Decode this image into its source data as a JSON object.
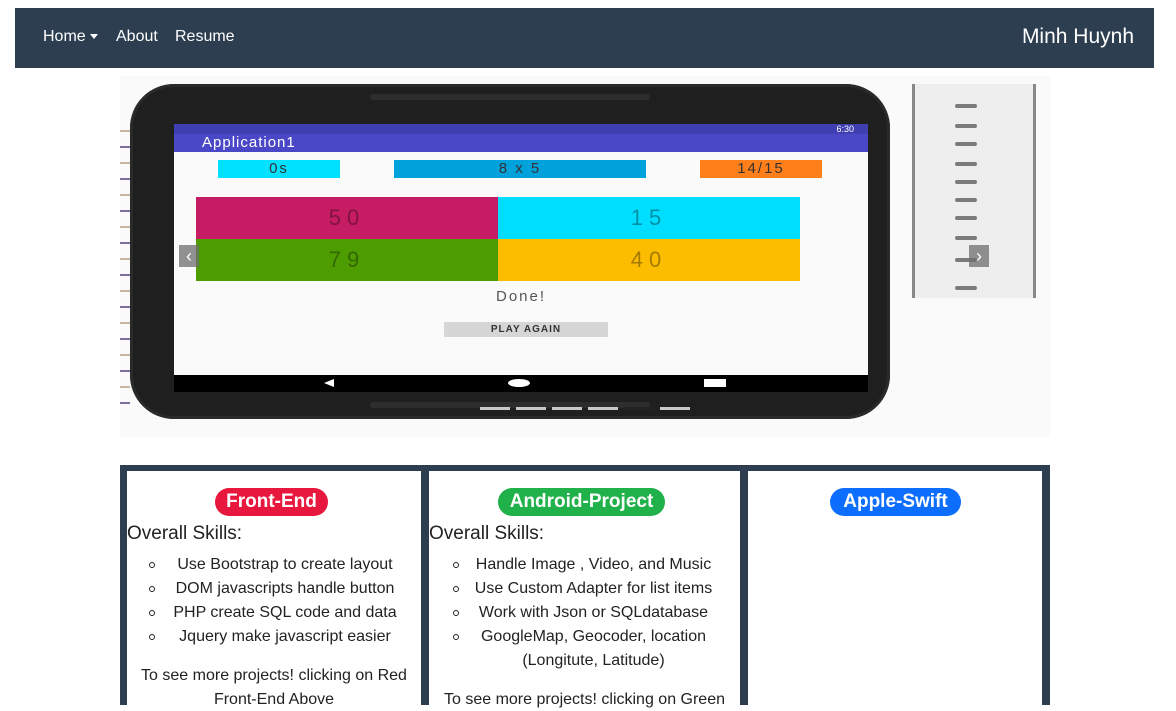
{
  "navbar": {
    "items": [
      {
        "label": "Home"
      },
      {
        "label": "About"
      },
      {
        "label": "Resume"
      }
    ],
    "brand": "Minh Huynh"
  },
  "carousel": {
    "app": {
      "status_time": "6:30",
      "title": "Application1",
      "time": "0s",
      "question": "8 x 5",
      "score": "14/15",
      "answers": [
        "50",
        "15",
        "79",
        "40"
      ],
      "done_text": "Done!",
      "play_again": "PLAY AGAIN"
    },
    "indicators": 6,
    "active_indicator": 4,
    "prev_icon": "chevron-left-icon",
    "next_icon": "chevron-right-icon"
  },
  "cards": [
    {
      "badge": "Front-End",
      "heading": "Overall Skills:",
      "skills": [
        "Use Bootstrap to create layout",
        "DOM javascripts handle button",
        "PHP create SQL code and data",
        "Jquery make javascript easier"
      ],
      "more": "To see more projects! clicking on Red Front-End Above"
    },
    {
      "badge": "Android-Project",
      "heading": "Overall Skills:",
      "skills": [
        "Handle Image , Video, and Music",
        "Use Custom Adapter for list items",
        "Work with Json or SQLdatabase",
        "GoogleMap, Geocoder, location (Longitute, Latitude)"
      ],
      "more": "To see more projects! clicking on Green"
    },
    {
      "badge": "Apple-Swift"
    }
  ],
  "colors": {
    "navbar_bg": "#2c3e50",
    "front_end": "#e8173d",
    "android": "#21b14a",
    "swift": "#0d6efd"
  }
}
